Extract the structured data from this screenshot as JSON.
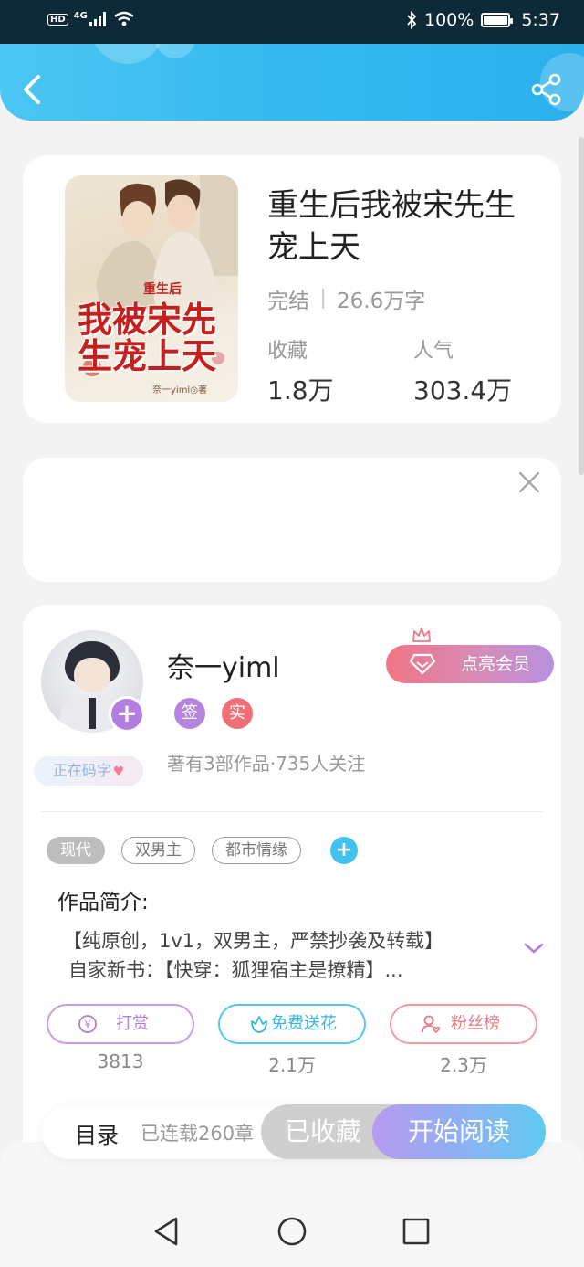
{
  "status_bar": {
    "hd": "HD",
    "network": "4G",
    "battery": "100%",
    "time": "5:37"
  },
  "header": {
    "back_icon": "chevron-left-icon",
    "share_icon": "share-icon"
  },
  "book": {
    "title": "重生后我被宋先生宠上天",
    "status": "完结",
    "word_count": "26.6万字",
    "collect_label": "收藏",
    "collect_value": "1.8万",
    "popularity_label": "人气",
    "popularity_value": "303.4万",
    "cover": {
      "title": "我被宋先生宠上天",
      "subtitle": "重生后",
      "author": "奈一yiml◎著"
    }
  },
  "ad": {
    "close_icon": "close-icon"
  },
  "author": {
    "name": "奈一yiml",
    "sign_tag": "签",
    "real_tag": "实",
    "stats": "著有3部作品·735人关注",
    "writing_status": "正在码字",
    "vip_label": "点亮会员"
  },
  "genres": [
    "现代",
    "双男主",
    "都市情缘"
  ],
  "intro": {
    "title": "作品简介:",
    "line1": "【纯原创，1v1，双男主，严禁抄袭及转载】",
    "line2": "自家新书：【快穿：狐狸宿主是撩精】..."
  },
  "actions": {
    "reward_label": "打赏",
    "reward_count": "3813",
    "flower_label": "免费送花",
    "flower_count": "2.1万",
    "fans_label": "粉丝榜",
    "fans_count": "2.3万"
  },
  "reader": {
    "toc_label": "目录",
    "chapters": "已连载260章",
    "collected_label": "已收藏",
    "start_label": "开始阅读"
  },
  "colors": {
    "header_blue": "#33b8ef",
    "accent_purple": "#b27ee0",
    "accent_pink": "#ef6f78"
  }
}
